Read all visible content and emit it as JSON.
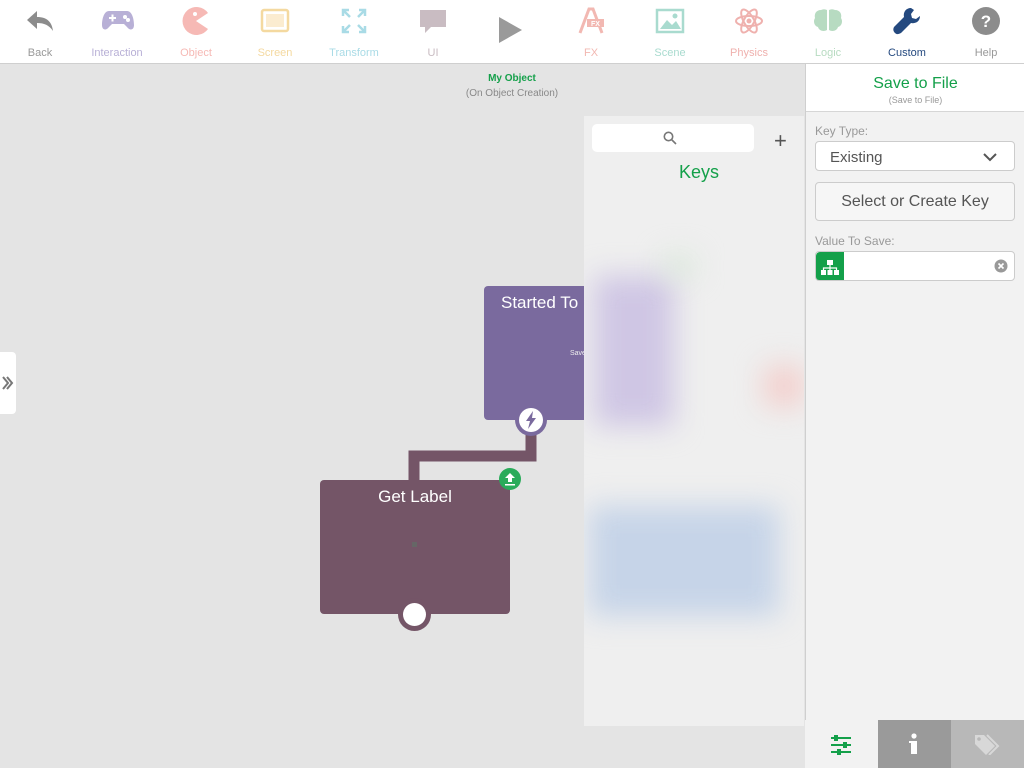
{
  "toolbar": {
    "items": [
      {
        "label": "Back",
        "icon": "back-arrow-icon",
        "color": "#8c8c8c"
      },
      {
        "label": "Interaction",
        "icon": "gamepad-icon",
        "color": "#b8b0d6"
      },
      {
        "label": "Object",
        "icon": "pacman-icon",
        "color": "#f6b9b5"
      },
      {
        "label": "Screen",
        "icon": "tablet-icon",
        "color": "#f4d9a0"
      },
      {
        "label": "Transform",
        "icon": "expand-arrows-icon",
        "color": "#a9dbe6"
      },
      {
        "label": "UI",
        "icon": "speech-bubble-icon",
        "color": "#c9bcc2"
      },
      {
        "label": "FX",
        "icon": "fx-icon",
        "color": "#f2b8b2"
      },
      {
        "label": "Scene",
        "icon": "image-icon",
        "color": "#a9dbcf"
      },
      {
        "label": "Physics",
        "icon": "atom-icon",
        "color": "#efb1ae"
      },
      {
        "label": "Logic",
        "icon": "brain-icon",
        "color": "#b7dbc1"
      },
      {
        "label": "Custom",
        "icon": "wrench-icon",
        "color": "#24497f"
      },
      {
        "label": "Help",
        "icon": "question-icon",
        "color": "#8c8c8c"
      }
    ],
    "play_icon": "play-icon"
  },
  "canvas": {
    "object_title": "My Object",
    "object_subtitle": "(On Object Creation)"
  },
  "nodes": {
    "started": {
      "title": "Started To",
      "subtitle": "Save"
    },
    "get_label": {
      "title": "Get Label"
    }
  },
  "keys_panel": {
    "title": "Keys",
    "add_label": "+"
  },
  "right_panel": {
    "title": "Save to File",
    "subtitle": "(Save to File)",
    "key_type_label": "Key Type:",
    "key_type_value": "Existing",
    "select_key_label": "Select or Create Key",
    "value_label": "Value To Save:"
  },
  "bottom_tabs": [
    {
      "icon": "sliders-icon"
    },
    {
      "icon": "info-icon"
    },
    {
      "icon": "tag-icon"
    }
  ],
  "colors": {
    "accent_green": "#14a04a",
    "node_purple": "#7a6a9e",
    "node_mauve": "#745567",
    "custom_blue": "#24497f"
  }
}
